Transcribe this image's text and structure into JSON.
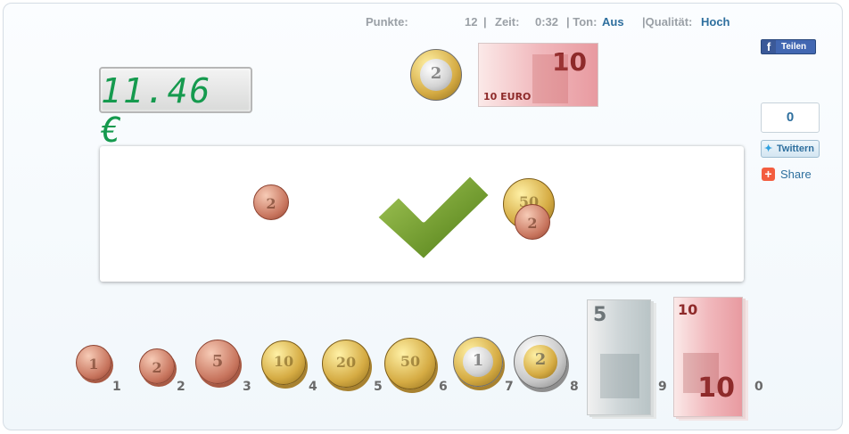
{
  "status": {
    "points_label": "Punkte:",
    "points_value": "12",
    "sep1": "|",
    "time_label": "Zeit:",
    "time_value": "0:32",
    "sound_label": "| Ton:",
    "sound_value": "Aus",
    "quality_label": "|Qualität:",
    "quality_value": "Hoch"
  },
  "display": {
    "amount": "11.46 €"
  },
  "target_items": [
    {
      "type": "coin",
      "label": "2"
    },
    {
      "type": "note",
      "value": "10",
      "small": "10 EURO"
    }
  ],
  "panel": {
    "coins_left": [
      {
        "label": "2"
      }
    ],
    "coins_right": [
      {
        "label": "50"
      },
      {
        "label": "2"
      }
    ],
    "checkmark": "correct"
  },
  "tray": [
    {
      "key": "1",
      "label": "1"
    },
    {
      "key": "2",
      "label": "2"
    },
    {
      "key": "3",
      "label": "5"
    },
    {
      "key": "4",
      "label": "10"
    },
    {
      "key": "5",
      "label": "20"
    },
    {
      "key": "6",
      "label": "50"
    },
    {
      "key": "7",
      "label": "1"
    },
    {
      "key": "8",
      "label": "2"
    },
    {
      "key": "9",
      "label": "5"
    },
    {
      "key": "0",
      "label": "10"
    }
  ],
  "social": {
    "facebook_label": "Teilen",
    "tweet_count": "0",
    "twitter_label": "Twittern",
    "share_label": "Share"
  },
  "colors": {
    "accent": "#2e6f9e",
    "lcd_digits": "#159a4e",
    "check": "#6f9a2a"
  }
}
